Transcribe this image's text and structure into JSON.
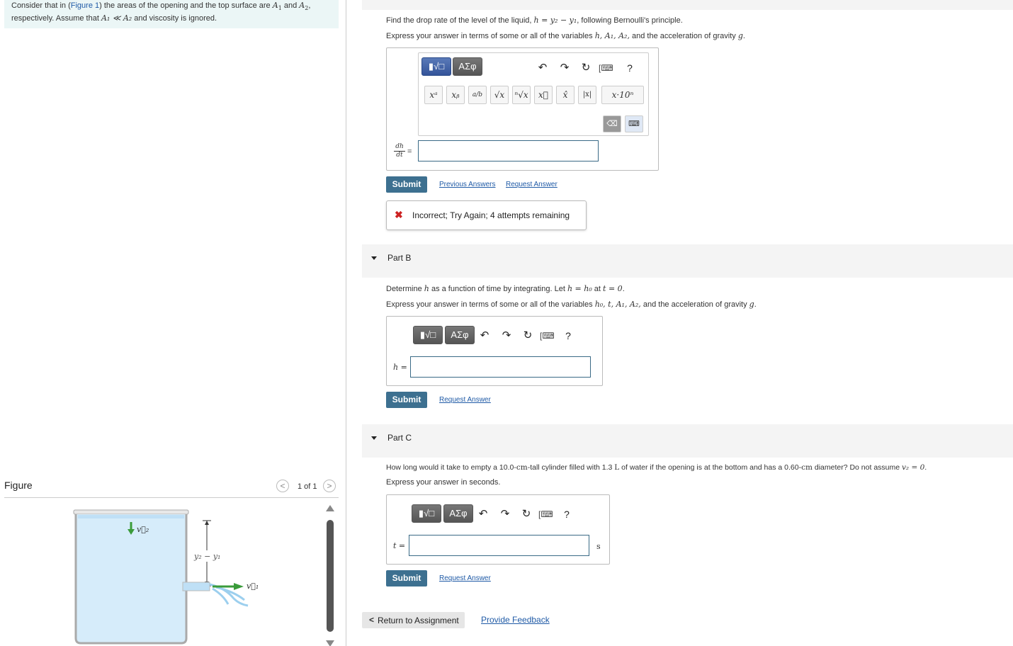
{
  "intro": {
    "line1_pre": "Consider that in (",
    "figure_link": "Figure 1",
    "line1_mid": ") the areas of the opening and the top surface are ",
    "A1": "A",
    "sub1": "1",
    "and": " and ",
    "A2": "A",
    "sub2": "2",
    "line1_end": ",",
    "line2_pre": "respectively. Assume that ",
    "line2_ineq": "A₁ ≪ A₂",
    "line2_end": " and viscosity is ignored."
  },
  "figure": {
    "title": "Figure",
    "prev": "<",
    "next": ">",
    "count": "1 of 1",
    "labels": {
      "v2": "v⃗₂",
      "diff": "y₂ − y₁",
      "v1": "v⃗₁"
    }
  },
  "partA": {
    "question": "Find the drop rate of the level of the liquid, ",
    "question_math": "h = y₂ − y₁",
    "question_end": ", following Bernoulli's principle.",
    "express_pre": "Express your answer in terms of some or all of the variables ",
    "express_vars": "h, A₁, A₂,",
    "express_end": " and the acceleration of gravity ",
    "g": "g",
    "dot": ".",
    "lhs_num": "dh",
    "lhs_den": "dt",
    "eq": "=",
    "submit": "Submit",
    "prev_answers": "Previous Answers",
    "request_answer": "Request Answer",
    "feedback_icon": "✖",
    "feedback": "Incorrect; Try Again; 4 attempts remaining"
  },
  "toolbar": {
    "templates": "▮√□",
    "greek": "AΣφ",
    "undo": "↶",
    "redo": "↷",
    "reset": "↻",
    "keyboard": "[⌨",
    "help": "?",
    "sym_power": "xᵃ",
    "sym_sub": "xᵦ",
    "sym_frac": "a/b",
    "sym_sqrt": "√x",
    "sym_nroot": "ⁿ√x",
    "sym_vec": "x⃗",
    "sym_hat": "x̂",
    "sym_abs": "|x|",
    "sym_sci": "x·10ⁿ",
    "delete": "⌫",
    "kbd2": "⌨"
  },
  "partB": {
    "label": "Part B",
    "question_pre": "Determine ",
    "h": "h",
    "question_mid": " as a function of time by integrating. Let ",
    "cond1": "h = h₀",
    "at": " at ",
    "cond2": "t = 0",
    "dot": ".",
    "express_pre": "Express your answer in terms of some or all of the variables ",
    "express_vars": "h₀, t, A₁, A₂,",
    "express_end": " and the acceleration of gravity ",
    "g": "g",
    "lhs": "h =",
    "submit": "Submit",
    "request_answer": "Request Answer"
  },
  "partC": {
    "label": "Part C",
    "question_pre": "How long would it take to empty a 10.0-",
    "cm1": "cm",
    "question_mid": "-tall cylinder filled with 1.3 ",
    "L": "L",
    "question_mid2": " of water if the opening is at the bottom and has a 0.60-",
    "cm2": "cm",
    "question_mid3": " diameter? Do not assume ",
    "v2cond": "v₂ = 0",
    "dot": ".",
    "express": "Express your answer in seconds.",
    "lhs": "t =",
    "unit": "s",
    "submit": "Submit",
    "request_answer": "Request Answer"
  },
  "footer": {
    "return": "Return to Assignment",
    "return_icon": "<",
    "feedback": "Provide Feedback"
  },
  "colors": {
    "submit_bg": "#3d7090",
    "link": "#1f5aa6",
    "error_x": "#cc2222",
    "water": "#d6ecfa",
    "arrow_green": "#3a9b3a",
    "intro_bg": "#ebf6f6"
  }
}
